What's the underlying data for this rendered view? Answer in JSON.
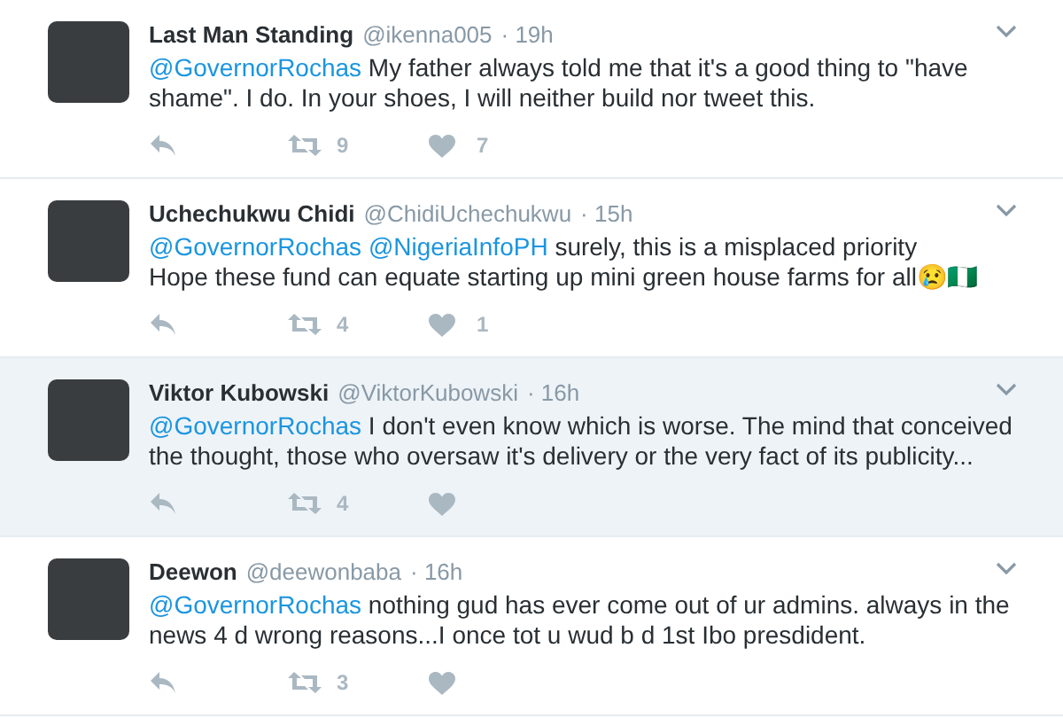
{
  "tweets": [
    {
      "name": "Last Man Standing",
      "handle": "@ikenna005",
      "time": "· 19h",
      "highlighted": false,
      "text": [
        {
          "kind": "mention",
          "text": "@GovernorRochas"
        },
        {
          "kind": "text",
          "text": " My father always told me that it's a good thing to \"have shame\". I do. In your shoes, I will neither build nor tweet this."
        }
      ],
      "retweets": "9",
      "likes": "7"
    },
    {
      "name": "Uchechukwu Chidi",
      "handle": "@ChidiUchechukwu",
      "time": "· 15h",
      "highlighted": false,
      "text": [
        {
          "kind": "mention",
          "text": "@GovernorRochas"
        },
        {
          "kind": "mention",
          "text": "@NigeriaInfoPH"
        },
        {
          "kind": "text",
          "text": " surely, this is a misplaced priority\nHope these fund can equate starting up mini green house farms for all😢🇳🇬"
        }
      ],
      "retweets": "4",
      "likes": "1"
    },
    {
      "name": "Viktor Kubowski",
      "handle": "@ViktorKubowski",
      "time": "· 16h",
      "highlighted": true,
      "text": [
        {
          "kind": "mention",
          "text": "@GovernorRochas"
        },
        {
          "kind": "text",
          "text": " I don't even know which is worse. The mind that conceived the thought, those who oversaw it's delivery or the very fact of its publicity..."
        }
      ],
      "retweets": "4"
    },
    {
      "name": "Deewon",
      "handle": "@deewonbaba",
      "time": "· 16h",
      "highlighted": false,
      "text": [
        {
          "kind": "mention",
          "text": "@GovernorRochas"
        },
        {
          "kind": "text",
          "text": " nothing gud has ever come out of ur admins. always in the news 4 d wrong reasons...I once tot u wud b d 1st Ibo presdident."
        }
      ],
      "retweets": "3"
    }
  ]
}
